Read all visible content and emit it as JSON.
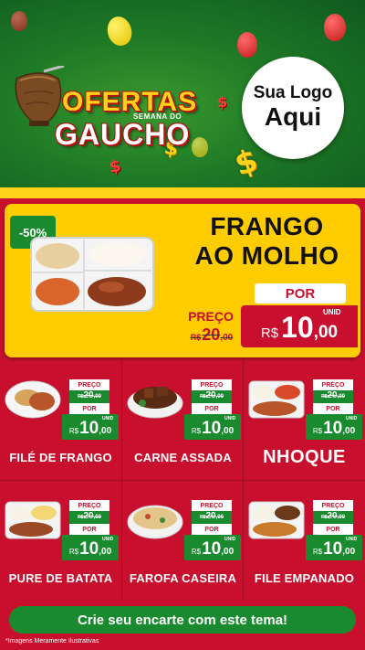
{
  "header": {
    "title_top": "OFERTAS",
    "title_sub": "SEMANA DO",
    "title_main": "GAUCHO",
    "logo_line1": "Sua Logo",
    "logo_line2": "Aqui"
  },
  "hero": {
    "discount": "-50%",
    "title_line1": "FRANGO",
    "title_line2": "AO MOLHO",
    "por_label": "POR",
    "preco_label": "PREÇO",
    "old_currency": "R$",
    "old_big": "20",
    "old_cents": ",00",
    "currency": "R$",
    "price_big": "10",
    "price_cents": ",00",
    "unid_label": "UNID"
  },
  "products": [
    {
      "name": "FILÉ DE FRANGO",
      "preco_label": "PREÇO",
      "old_currency": "R$",
      "old_big": "20",
      "old_cents": ",00",
      "por_label": "POR",
      "currency": "R$",
      "price_big": "10",
      "price_cents": ",00",
      "unid": "UNID"
    },
    {
      "name": "CARNE ASSADA",
      "preco_label": "PREÇO",
      "old_currency": "R$",
      "old_big": "20",
      "old_cents": ",00",
      "por_label": "POR",
      "currency": "R$",
      "price_big": "10",
      "price_cents": ",00",
      "unid": "UNID"
    },
    {
      "name": "NHOQUE",
      "preco_label": "PREÇO",
      "old_currency": "R$",
      "old_big": "20",
      "old_cents": ",00",
      "por_label": "POR",
      "currency": "R$",
      "price_big": "10",
      "price_cents": ",00",
      "unid": "UNID"
    },
    {
      "name": "PURE DE BATATA",
      "preco_label": "PREÇO",
      "old_currency": "R$",
      "old_big": "20",
      "old_cents": ",00",
      "por_label": "POR",
      "currency": "R$",
      "price_big": "10",
      "price_cents": ",00",
      "unid": "UNID"
    },
    {
      "name": "FAROFA CASEIRA",
      "preco_label": "PREÇO",
      "old_currency": "R$",
      "old_big": "20",
      "old_cents": ",00",
      "por_label": "POR",
      "currency": "R$",
      "price_big": "10",
      "price_cents": ",00",
      "unid": "UNID"
    },
    {
      "name": "FILE EMPANADO",
      "preco_label": "PREÇO",
      "old_currency": "R$",
      "old_big": "20",
      "old_cents": ",00",
      "por_label": "POR",
      "currency": "R$",
      "price_big": "10",
      "price_cents": ",00",
      "unid": "UNID"
    }
  ],
  "cta": {
    "label": "Crie seu encarte com este tema!"
  },
  "footnote": "*Imagens Meramente Ilustrativas",
  "colors": {
    "red": "#c8102e",
    "green": "#1a8a2e",
    "yellow": "#ffcc00",
    "header_green": "#1f7a26"
  }
}
